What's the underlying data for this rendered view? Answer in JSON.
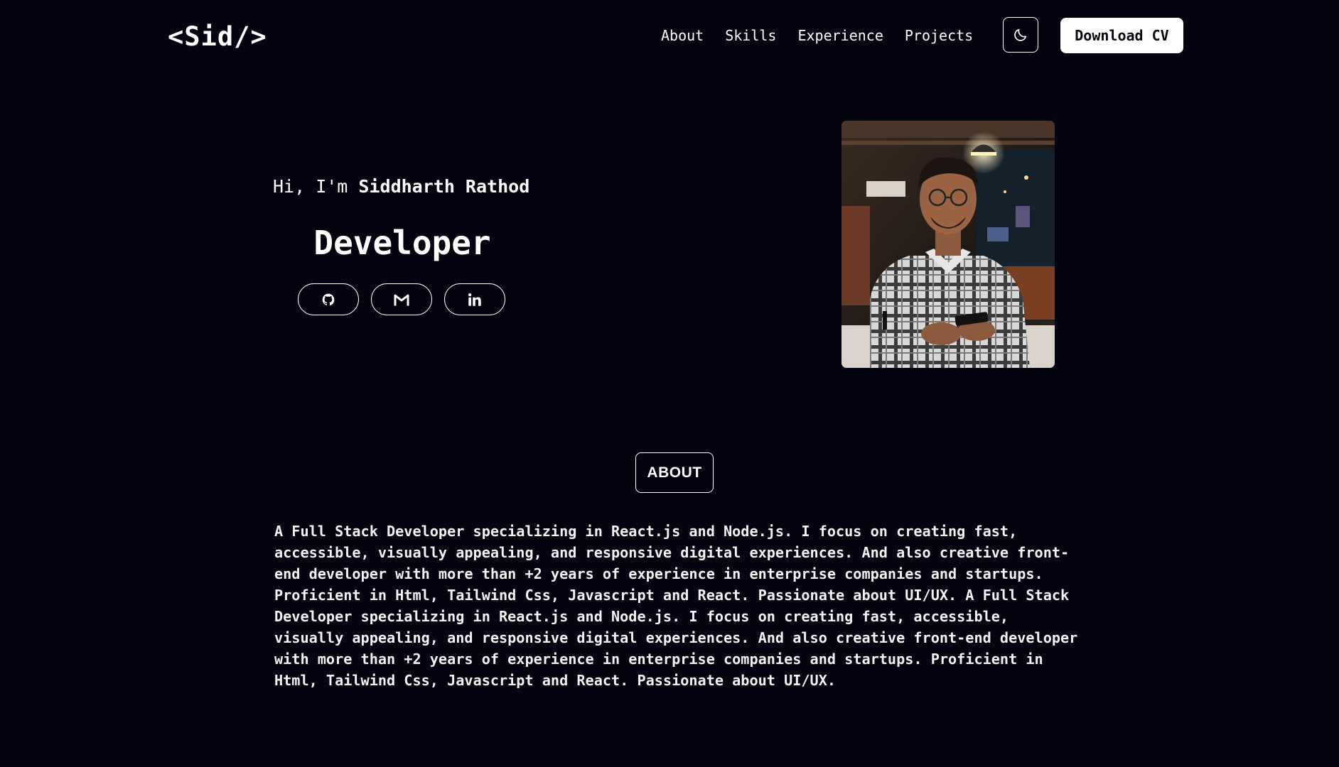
{
  "header": {
    "logo": "<Sid/>",
    "nav": [
      {
        "label": "About"
      },
      {
        "label": "Skills"
      },
      {
        "label": "Experience"
      },
      {
        "label": "Projects"
      }
    ],
    "theme_toggle_icon": "moon-icon",
    "download_label": "Download CV"
  },
  "hero": {
    "greeting_prefix": "Hi, I'm ",
    "name": "Siddharth Rathod",
    "role": "Developer",
    "socials": [
      {
        "icon": "github-icon"
      },
      {
        "icon": "gmail-icon"
      },
      {
        "icon": "linkedin-icon"
      }
    ],
    "photo": "portrait photo of man in plaid shirt holding phone in cafe"
  },
  "about": {
    "heading": "ABOUT",
    "text": "A Full Stack Developer specializing in React.js and Node.js. I focus on creating fast,\naccessible, visually appealing, and responsive digital experiences. And also creative front-\nend developer with more than +2 years of experience in enterprise companies and startups.\nProficient in Html, Tailwind Css, Javascript and React. Passionate about UI/UX. A Full Stack\nDeveloper specializing in React.js and Node.js. I focus on creating fast, accessible,\nvisually appealing, and responsive digital experiences. And also creative front-end developer\nwith more than +2 years of experience in enterprise companies and startups. Proficient in\nHtml, Tailwind Css, Javascript and React. Passionate about UI/UX."
  },
  "colors": {
    "background": "#03040f",
    "foreground": "#ffffff"
  }
}
